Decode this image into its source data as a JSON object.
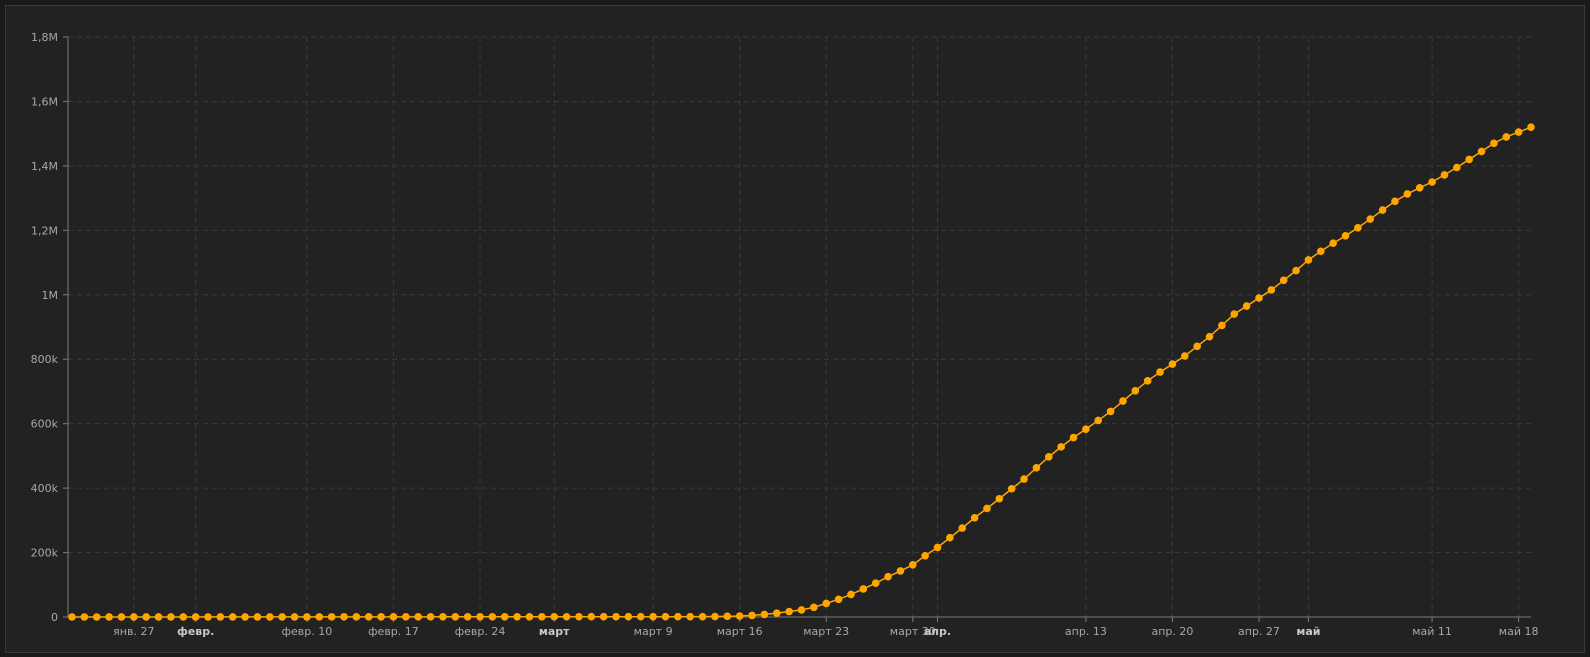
{
  "chart_data": {
    "type": "line",
    "title": "",
    "xlabel": "",
    "ylabel": "",
    "x_start": "2020-01-22",
    "x_end": "2020-05-19",
    "xlim": [
      "2020-01-22",
      "2020-05-19"
    ],
    "ylim": [
      0,
      1800000
    ],
    "grid": true,
    "legend": "none",
    "marker": "circle",
    "y_ticks": [
      {
        "value": 0,
        "label": "0"
      },
      {
        "value": 200000,
        "label": "200k"
      },
      {
        "value": 400000,
        "label": "400k"
      },
      {
        "value": 600000,
        "label": "600k"
      },
      {
        "value": 800000,
        "label": "800k"
      },
      {
        "value": 1000000,
        "label": "1M"
      },
      {
        "value": 1200000,
        "label": "1,2M"
      },
      {
        "value": 1400000,
        "label": "1,4M"
      },
      {
        "value": 1600000,
        "label": "1,6M"
      },
      {
        "value": 1800000,
        "label": "1,8M"
      }
    ],
    "x_ticks": [
      {
        "date": "2020-01-27",
        "label": "янв. 27",
        "major": false
      },
      {
        "date": "2020-02-01",
        "label": "февр.",
        "major": true
      },
      {
        "date": "2020-02-10",
        "label": "февр. 10",
        "major": false
      },
      {
        "date": "2020-02-17",
        "label": "февр. 17",
        "major": false
      },
      {
        "date": "2020-02-24",
        "label": "февр. 24",
        "major": false
      },
      {
        "date": "2020-03-01",
        "label": "март",
        "major": true
      },
      {
        "date": "2020-03-09",
        "label": "март 9",
        "major": false
      },
      {
        "date": "2020-03-16",
        "label": "март 16",
        "major": false
      },
      {
        "date": "2020-03-23",
        "label": "март 23",
        "major": false
      },
      {
        "date": "2020-03-30",
        "label": "март 30",
        "major": false
      },
      {
        "date": "2020-04-01",
        "label": "апр.",
        "major": true
      },
      {
        "date": "2020-04-13",
        "label": "апр. 13",
        "major": false
      },
      {
        "date": "2020-04-20",
        "label": "апр. 20",
        "major": false
      },
      {
        "date": "2020-04-27",
        "label": "апр. 27",
        "major": false
      },
      {
        "date": "2020-05-01",
        "label": "май",
        "major": true
      },
      {
        "date": "2020-05-11",
        "label": "май 11",
        "major": false
      },
      {
        "date": "2020-05-18",
        "label": "май 18",
        "major": false
      }
    ],
    "series": [
      {
        "color": "#ffa500",
        "points": [
          [
            "2020-01-22",
            0
          ],
          [
            "2020-03-13",
            1000
          ],
          [
            "2020-03-14",
            1500
          ],
          [
            "2020-03-15",
            2000
          ],
          [
            "2020-03-16",
            3000
          ],
          [
            "2020-03-17",
            5000
          ],
          [
            "2020-03-18",
            8000
          ],
          [
            "2020-03-19",
            12000
          ],
          [
            "2020-03-20",
            17000
          ],
          [
            "2020-03-21",
            22000
          ],
          [
            "2020-03-22",
            30000
          ],
          [
            "2020-03-23",
            42000
          ],
          [
            "2020-03-24",
            55000
          ],
          [
            "2020-03-25",
            70000
          ],
          [
            "2020-03-26",
            87000
          ],
          [
            "2020-03-27",
            105000
          ],
          [
            "2020-03-28",
            125000
          ],
          [
            "2020-03-29",
            143000
          ],
          [
            "2020-03-30",
            162000
          ],
          [
            "2020-03-31",
            190000
          ],
          [
            "2020-04-01",
            216000
          ],
          [
            "2020-04-02",
            246000
          ],
          [
            "2020-04-03",
            276000
          ],
          [
            "2020-04-04",
            308000
          ],
          [
            "2020-04-05",
            337000
          ],
          [
            "2020-04-06",
            367000
          ],
          [
            "2020-04-07",
            398000
          ],
          [
            "2020-04-08",
            428000
          ],
          [
            "2020-04-09",
            463000
          ],
          [
            "2020-04-10",
            497000
          ],
          [
            "2020-04-11",
            528000
          ],
          [
            "2020-04-12",
            557000
          ],
          [
            "2020-04-13",
            583000
          ],
          [
            "2020-04-14",
            610000
          ],
          [
            "2020-04-15",
            638000
          ],
          [
            "2020-04-16",
            670000
          ],
          [
            "2020-04-17",
            702000
          ],
          [
            "2020-04-18",
            733000
          ],
          [
            "2020-04-19",
            760000
          ],
          [
            "2020-04-20",
            785000
          ],
          [
            "2020-04-21",
            810000
          ],
          [
            "2020-04-22",
            840000
          ],
          [
            "2020-04-23",
            870000
          ],
          [
            "2020-04-24",
            905000
          ],
          [
            "2020-04-25",
            940000
          ],
          [
            "2020-04-26",
            965000
          ],
          [
            "2020-04-27",
            990000
          ],
          [
            "2020-04-28",
            1015000
          ],
          [
            "2020-04-29",
            1045000
          ],
          [
            "2020-04-30",
            1075000
          ],
          [
            "2020-05-01",
            1108000
          ],
          [
            "2020-05-02",
            1135000
          ],
          [
            "2020-05-03",
            1160000
          ],
          [
            "2020-05-04",
            1183000
          ],
          [
            "2020-05-05",
            1208000
          ],
          [
            "2020-05-06",
            1235000
          ],
          [
            "2020-05-07",
            1263000
          ],
          [
            "2020-05-08",
            1290000
          ],
          [
            "2020-05-09",
            1313000
          ],
          [
            "2020-05-10",
            1332000
          ],
          [
            "2020-05-11",
            1350000
          ],
          [
            "2020-05-12",
            1372000
          ],
          [
            "2020-05-13",
            1395000
          ],
          [
            "2020-05-14",
            1420000
          ],
          [
            "2020-05-15",
            1445000
          ],
          [
            "2020-05-16",
            1470000
          ],
          [
            "2020-05-17",
            1490000
          ],
          [
            "2020-05-18",
            1505000
          ],
          [
            "2020-05-19",
            1520000
          ]
        ]
      }
    ]
  }
}
